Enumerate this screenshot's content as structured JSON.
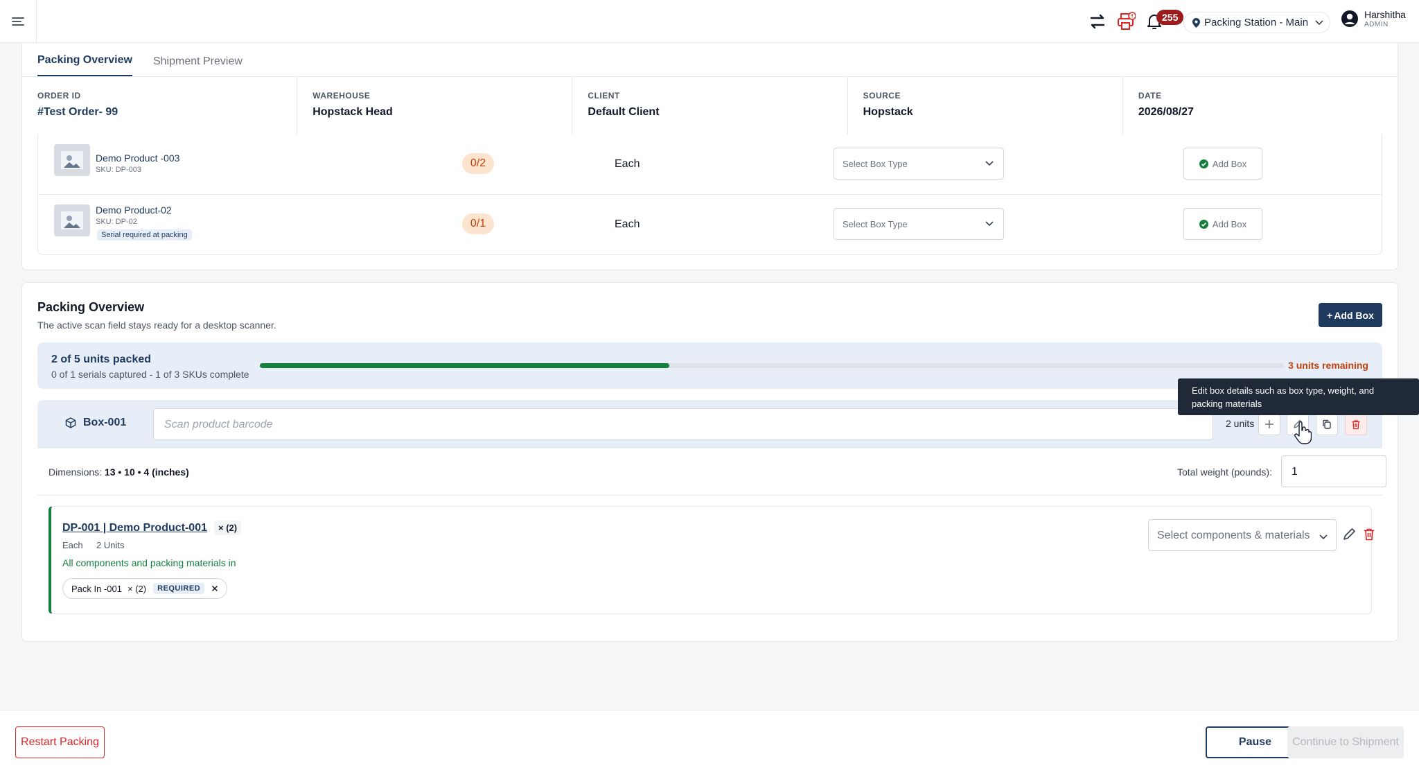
{
  "topbar": {
    "notification_count": "255",
    "station_label": "Packing Station - Main",
    "user_name": "Harshitha",
    "user_role": "ADMIN"
  },
  "tabs": [
    {
      "label": "Packing Overview",
      "active": true
    },
    {
      "label": "Shipment Preview",
      "active": false
    }
  ],
  "order": {
    "order_id_label": "ORDER ID",
    "order_id": "#Test Order- 99",
    "warehouse_label": "WAREHOUSE",
    "warehouse": "Hopstack Head",
    "client_label": "CLIENT",
    "client": "Default Client",
    "source_label": "SOURCE",
    "source": "Hopstack",
    "date_label": "DATE",
    "date": "2026/08/27"
  },
  "products": [
    {
      "name": "Demo Product -003",
      "sku": "SKU: DP-003",
      "qty": "0/2",
      "uom": "Each",
      "box_type_placeholder": "Select Box Type",
      "add_box_label": "Add Box",
      "serial_tag": ""
    },
    {
      "name": "Demo Product-02",
      "sku": "SKU: DP-02",
      "qty": "0/1",
      "uom": "Each",
      "box_type_placeholder": "Select Box Type",
      "add_box_label": "Add Box",
      "serial_tag": "Serial required at packing"
    }
  ],
  "packing": {
    "title": "Packing Overview",
    "subtitle": "The active scan field stays ready for a desktop scanner.",
    "add_box_label": "Add Box",
    "progress_title": "2 of 5 units packed",
    "progress_sub": "0 of 1 serials captured - 1 of 3 SKUs complete",
    "progress_fraction": 0.4,
    "remaining": "3 units remaining"
  },
  "box": {
    "name": "Box-001",
    "scan_placeholder": "Scan product barcode",
    "units": "2 units",
    "dimensions_label": "Dimensions:",
    "dimensions_value": "13 • 10 • 4 (inches)",
    "weight_label": "Total weight (pounds):",
    "weight_value": "1"
  },
  "item": {
    "name": "DP-001 | Demo Product-001",
    "multiplier": "× (2)",
    "uom": "Each",
    "units": "2 Units",
    "status": "All components and packing materials in",
    "chip_name": "Pack In -001",
    "chip_qty": "× (2)",
    "chip_required": "REQUIRED",
    "components_placeholder": "Select components & materials"
  },
  "tooltip": "Edit box details such as box type, weight, and packing materials",
  "footer": {
    "restart_label": "Restart Packing",
    "pause_label": "Pause",
    "continue_label": "Continue to Shipment"
  },
  "colors": {
    "brand": "#1e3a5f",
    "success": "#15803d",
    "warning": "#c2410c",
    "danger": "#dc2626"
  }
}
